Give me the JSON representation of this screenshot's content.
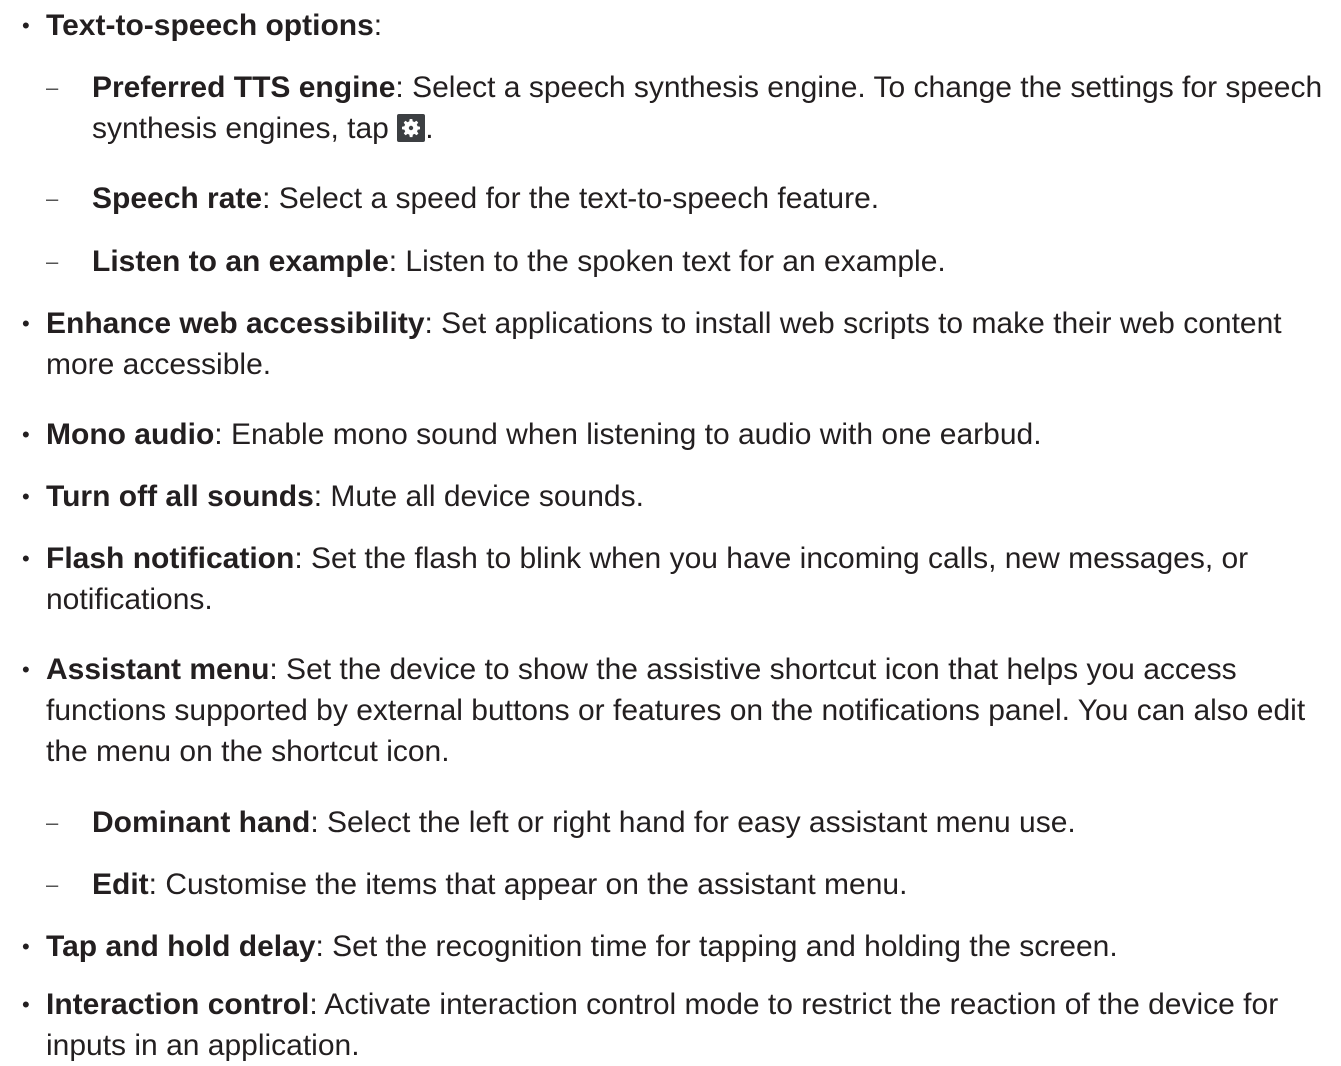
{
  "bullets": {
    "dot": "•",
    "dash": "–"
  },
  "items": [
    {
      "term": "Text-to-speech options",
      "text": ":"
    },
    {
      "term": "Preferred TTS engine",
      "text": ": Select a speech synthesis engine. To change the settings for speech synthesis engines, tap ",
      "after_icon": "."
    },
    {
      "term": "Speech rate",
      "text": ": Select a speed for the text-to-speech feature."
    },
    {
      "term": "Listen to an example",
      "text": ": Listen to the spoken text for an example."
    },
    {
      "term": "Enhance web accessibility",
      "text": ": Set applications to install web scripts to make their web content more accessible."
    },
    {
      "term": "Mono audio",
      "text": ": Enable mono sound when listening to audio with one earbud."
    },
    {
      "term": "Turn off all sounds",
      "text": ": Mute all device sounds."
    },
    {
      "term": "Flash notification",
      "text": ": Set the flash to blink when you have incoming calls, new messages, or notifications."
    },
    {
      "term": "Assistant menu",
      "text": ": Set the device to show the assistive shortcut icon that helps you access functions supported by external buttons or features on the notifications panel. You can also edit the menu on the shortcut icon."
    },
    {
      "term": "Dominant hand",
      "text": ": Select the left or right hand for easy assistant menu use."
    },
    {
      "term": "Edit",
      "text": ": Customise the items that appear on the assistant menu."
    },
    {
      "term": "Tap and hold delay",
      "text": ": Set the recognition time for tapping and holding the screen."
    },
    {
      "term": "Interaction control",
      "text": ": Activate interaction control mode to restrict the reaction of the device for inputs in an application."
    }
  ],
  "icons": {
    "settings": "gear-icon"
  }
}
